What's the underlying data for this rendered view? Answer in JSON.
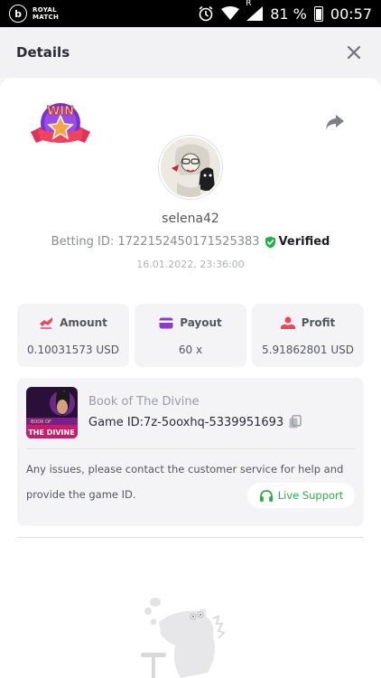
{
  "status_bar": {
    "brand": "ROYAL MATCH",
    "battery": "81 %",
    "time": "00:57",
    "signal_label": "R"
  },
  "header": {
    "title": "Details"
  },
  "bet": {
    "username": "selena42",
    "betting_id_label": "Betting ID: 1722152450171525383",
    "verified_label": "Verified",
    "timestamp": "16.01.2022, 23:36:00"
  },
  "stats": [
    {
      "label": "Amount",
      "value": "0.10031573 USD",
      "icon": "amount-icon",
      "color": "#f0445e"
    },
    {
      "label": "Payout",
      "value": "60 x",
      "icon": "wallet-icon",
      "color": "#8a3bd6"
    },
    {
      "label": "Profit",
      "value": "5.91862801 USD",
      "icon": "profit-icon",
      "color": "#f0445e"
    }
  ],
  "game": {
    "name": "Book of The Divine",
    "game_id": "Game ID:7z-5ooxhq-5339951693",
    "thumb_title": "BOOK OF THE DIVINE"
  },
  "support": {
    "notice_line1": "Any issues, please contact the customer service for help and",
    "notice_line2": "provide the game ID.",
    "button_label": "Live Support"
  },
  "badge": {
    "text": "WIN"
  },
  "colors": {
    "accent_green": "#2ab04a",
    "verified_green": "#22b14c",
    "text_primary": "#2b2c31"
  }
}
